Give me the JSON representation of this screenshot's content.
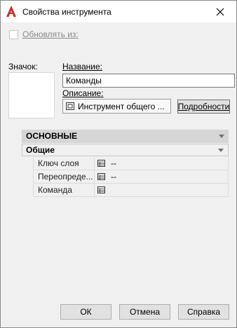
{
  "window": {
    "title": "Свойства инструмента"
  },
  "update_from": {
    "label": "Обновлять из:",
    "checked": false
  },
  "icon_section": {
    "label": "Значок:"
  },
  "name": {
    "label": "Название:",
    "value": "Команды"
  },
  "description": {
    "label": "Описание:",
    "value": "Инструмент общего ..."
  },
  "details_button": {
    "label": "Подробности"
  },
  "properties": {
    "category": "ОСНОВНЫЕ",
    "group": "Общие",
    "rows": [
      {
        "name": "Ключ слоя",
        "value": "--"
      },
      {
        "name": "Переопреде...",
        "value": "--"
      },
      {
        "name": "Команда",
        "value": ""
      }
    ]
  },
  "buttons": {
    "ok": "ОК",
    "cancel": "Отмена",
    "help": "Справка"
  }
}
